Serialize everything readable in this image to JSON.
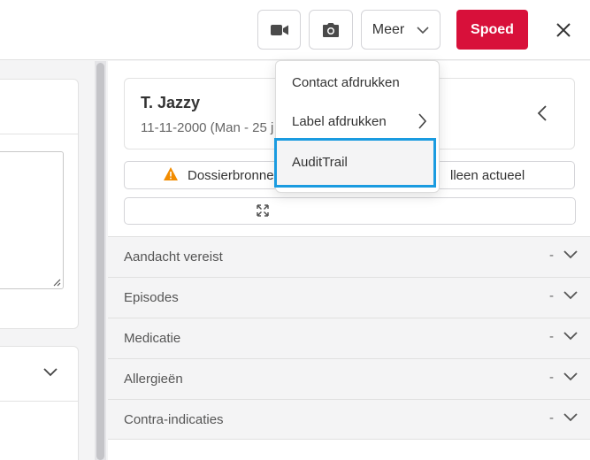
{
  "toolbar": {
    "meer_label": "Meer",
    "spoed_label": "Spoed"
  },
  "patient": {
    "name": "T. Jazzy",
    "dob_line": "11-11-2000 (Man - 25 j"
  },
  "dossier": {
    "left_text": "Dossierbronne",
    "right_text": "lleen actueel"
  },
  "sections": [
    {
      "label": "Aandacht vereist",
      "dash": "-"
    },
    {
      "label": "Episodes",
      "dash": "-"
    },
    {
      "label": "Medicatie",
      "dash": "-"
    },
    {
      "label": "Allergieën",
      "dash": "-"
    },
    {
      "label": "Contra-indicaties",
      "dash": "-"
    }
  ],
  "menu": {
    "items": [
      "Contact afdrukken",
      "Label afdrukken",
      "AuditTrail"
    ]
  },
  "colors": {
    "spoed": "#d8103a",
    "highlight_border": "#1a9be0",
    "warning": "#f28c00"
  },
  "icons": [
    "video-icon",
    "camera-icon",
    "chevron-down-icon",
    "close-icon",
    "chevron-left-icon",
    "warning-icon",
    "expand-icon",
    "chevron-right-icon"
  ]
}
